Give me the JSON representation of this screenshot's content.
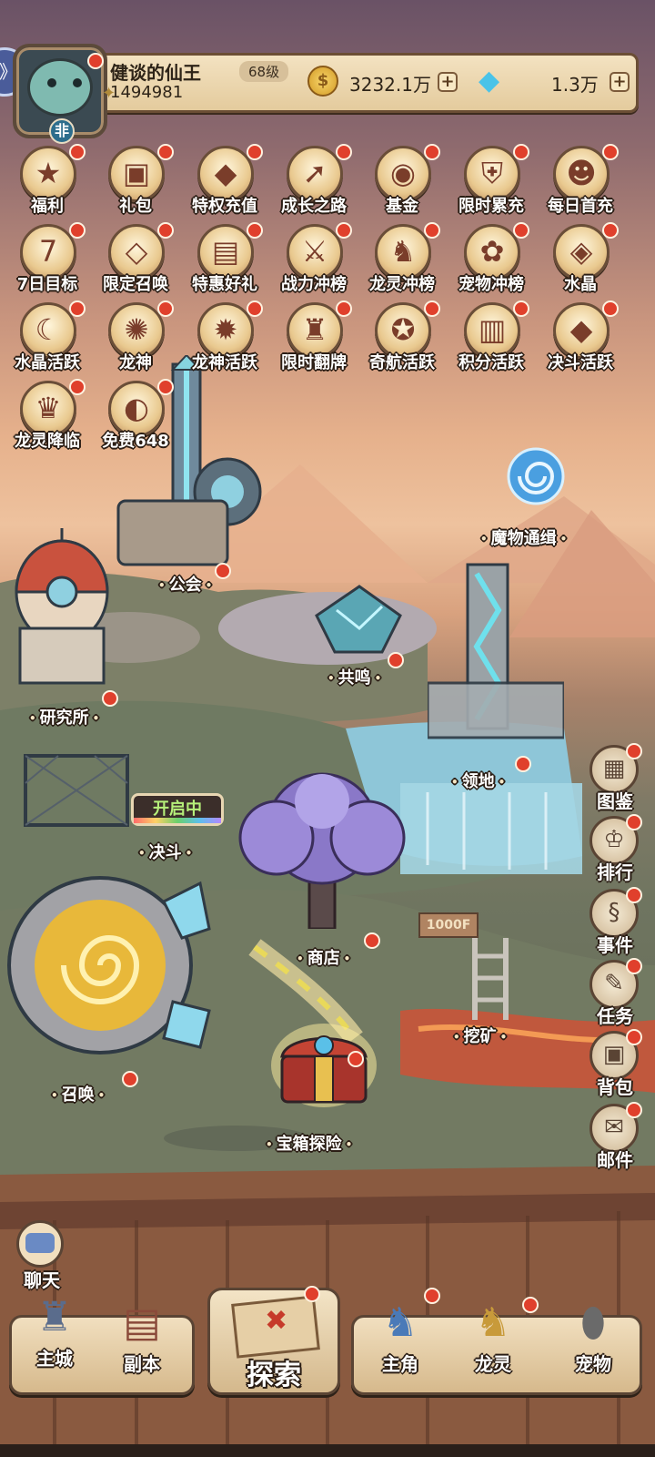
{
  "header": {
    "player_name": "健谈的仙王",
    "level": "68级",
    "power": "1494981",
    "rank_badge": "非",
    "gold": "3232.1万",
    "diamonds": "1.3万",
    "plus_symbol": "+",
    "back_symbol": "》"
  },
  "activity_icons": [
    {
      "label": "福利",
      "icon": "gift-card-icon",
      "glyph": "★"
    },
    {
      "label": "礼包",
      "icon": "treasure-chest-icon",
      "glyph": "▣"
    },
    {
      "label": "特权充值",
      "icon": "crystal-card-icon",
      "glyph": "◆"
    },
    {
      "label": "成长之路",
      "icon": "growth-bird-icon",
      "glyph": "➚"
    },
    {
      "label": "基金",
      "icon": "money-bag-icon",
      "glyph": "◉"
    },
    {
      "label": "限时累充",
      "icon": "armor-icon",
      "glyph": "⛨"
    },
    {
      "label": "每日首充",
      "icon": "character-portrait-icon",
      "glyph": "☻"
    },
    {
      "label": "7日目标",
      "icon": "seven-day-icon",
      "glyph": "7"
    },
    {
      "label": "限定召唤",
      "icon": "summon-crystal-icon",
      "glyph": "◇"
    },
    {
      "label": "特惠好礼",
      "icon": "scroll-icon",
      "glyph": "▤"
    },
    {
      "label": "战力冲榜",
      "icon": "power-wing-icon",
      "glyph": "⚔"
    },
    {
      "label": "龙灵冲榜",
      "icon": "dragon-spirit-icon",
      "glyph": "♞"
    },
    {
      "label": "宠物冲榜",
      "icon": "pet-icon",
      "glyph": "✿"
    },
    {
      "label": "水晶",
      "icon": "green-crystal-icon",
      "glyph": "◈"
    },
    {
      "label": "水晶活跃",
      "icon": "rainbow-character-icon",
      "glyph": "☾"
    },
    {
      "label": "龙神",
      "icon": "dragon-god-icon",
      "glyph": "✺"
    },
    {
      "label": "龙神活跃",
      "icon": "firework-icon",
      "glyph": "✹"
    },
    {
      "label": "限时翻牌",
      "icon": "magic-hat-icon",
      "glyph": "♜"
    },
    {
      "label": "奇航活跃",
      "icon": "compass-icon",
      "glyph": "✪"
    },
    {
      "label": "积分活跃",
      "icon": "ticket-icon",
      "glyph": "▥"
    },
    {
      "label": "决斗活跃",
      "icon": "kite-icon",
      "glyph": "◆"
    },
    {
      "label": "龙灵降临",
      "icon": "horned-girl-icon",
      "glyph": "♛"
    },
    {
      "label": "免费648",
      "icon": "free-capsule-icon",
      "glyph": "◐"
    }
  ],
  "map_locations": {
    "guild": "公会",
    "research": "研究所",
    "resonance": "共鸣",
    "monster_hunt": "魔物通缉",
    "territory": "领地",
    "duel": "决斗",
    "duel_status": "开启中",
    "shop": "商店",
    "mining": "挖矿",
    "summon": "召唤",
    "treasure": "宝箱探险",
    "sign": "1000F"
  },
  "side_menu": [
    {
      "label": "图鉴",
      "icon": "codex-icon",
      "glyph": "▦"
    },
    {
      "label": "排行",
      "icon": "trophy-icon",
      "glyph": "♔"
    },
    {
      "label": "事件",
      "icon": "event-scroll-icon",
      "glyph": "§"
    },
    {
      "label": "任务",
      "icon": "quest-scroll-icon",
      "glyph": "✎"
    },
    {
      "label": "背包",
      "icon": "backpack-icon",
      "glyph": "▣"
    },
    {
      "label": "邮件",
      "icon": "mail-icon",
      "glyph": "✉"
    }
  ],
  "chat": {
    "label": "聊天"
  },
  "bottom_nav": {
    "main_city": "主城",
    "dungeon": "副本",
    "explore": "探索",
    "hero": "主角",
    "dragon": "龙灵",
    "pet": "宠物"
  },
  "colors": {
    "notify": "#e0402c",
    "panel": "#efdcb8",
    "outline": "#2a1d14"
  }
}
